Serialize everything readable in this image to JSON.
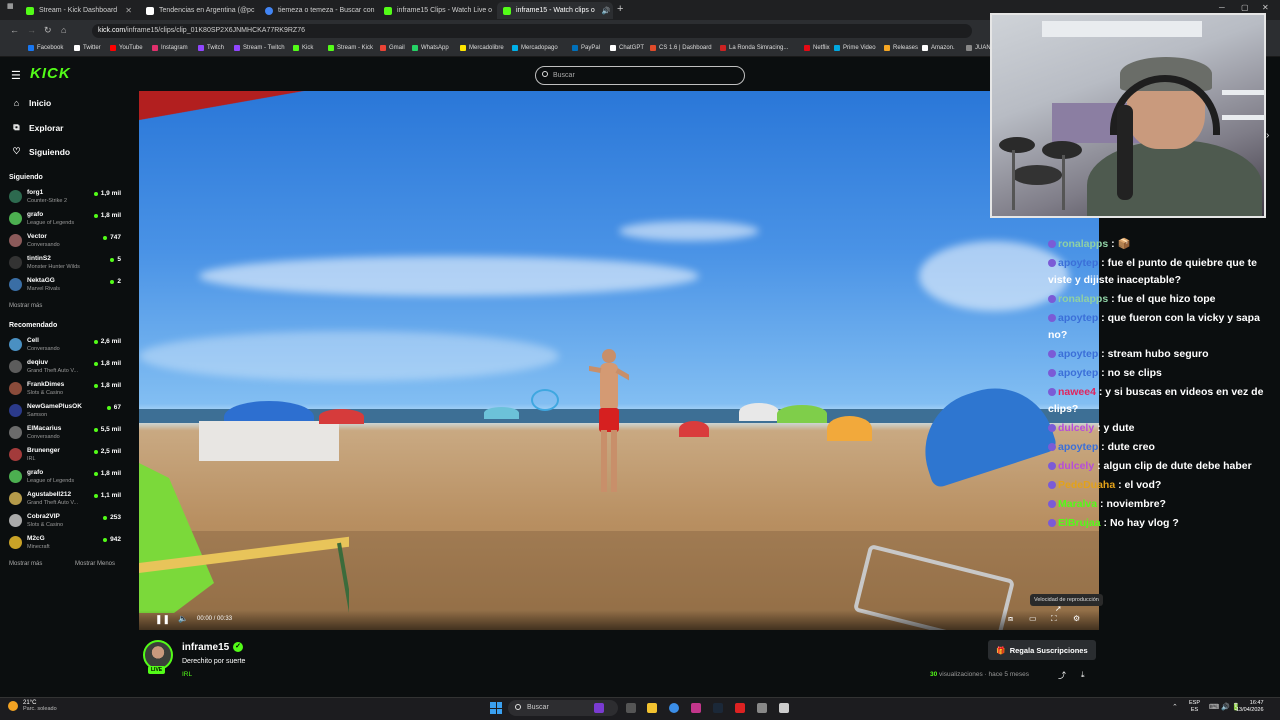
{
  "browser": {
    "tabs": [
      {
        "title": "Stream - Kick Dashboard",
        "color": "#53fc18"
      },
      {
        "title": "Tendencias en Argentina (@pc",
        "color": "#ffffff"
      },
      {
        "title": "tiemeza o temeza - Buscar con",
        "color": "#4285f4"
      },
      {
        "title": "inframe15 Clips - Watch Live o",
        "color": "#53fc18"
      },
      {
        "title": "inframe15 - Watch clips o",
        "color": "#53fc18"
      }
    ],
    "url_host": "kick.com",
    "url_path": "/inframe15/clips/clip_01K80SP2X6JNMHCKA77RK9RZ76",
    "bookmarks": [
      {
        "label": "Facebook",
        "color": "#1877f2"
      },
      {
        "label": "Twitter",
        "color": "#ffffff"
      },
      {
        "label": "YouTube",
        "color": "#ff0000"
      },
      {
        "label": "Instagram",
        "color": "#e1306c"
      },
      {
        "label": "Twitch",
        "color": "#9146ff"
      },
      {
        "label": "Stream - Twitch",
        "color": "#9146ff"
      },
      {
        "label": "Kick",
        "color": "#53fc18"
      },
      {
        "label": "Stream - Kick",
        "color": "#53fc18"
      },
      {
        "label": "Gmail",
        "color": "#ea4335"
      },
      {
        "label": "WhatsApp",
        "color": "#25d366"
      },
      {
        "label": "Mercadolibre",
        "color": "#ffe600"
      },
      {
        "label": "Mercadopago",
        "color": "#00b1ea"
      },
      {
        "label": "PayPal",
        "color": "#0070ba"
      },
      {
        "label": "ChatGPT",
        "color": "#ffffff"
      },
      {
        "label": "CS 1.6 | Dashboard",
        "color": "#e04b2a"
      },
      {
        "label": "La Ronda Simracing...",
        "color": "#cc2222"
      },
      {
        "label": "Netflix",
        "color": "#e50914"
      },
      {
        "label": "Prime Video",
        "color": "#00a8e1"
      },
      {
        "label": "Releases",
        "color": "#f5a623"
      },
      {
        "label": "Amazon.",
        "color": "#ffffff"
      },
      {
        "label": "JUAN",
        "color": "#888888"
      }
    ]
  },
  "kick": {
    "logo": "KICK",
    "search_placeholder": "Buscar",
    "nav": [
      {
        "label": "Inicio",
        "icon": "home-icon"
      },
      {
        "label": "Explorar",
        "icon": "compass-icon"
      },
      {
        "label": "Siguiendo",
        "icon": "heart-icon"
      }
    ],
    "following_header": "Siguiendo",
    "following": [
      {
        "name": "forg1",
        "game": "Counter-Strike 2",
        "viewers": "1,9 mil",
        "color": "#2d6a4f"
      },
      {
        "name": "grafo",
        "game": "League of Legends",
        "viewers": "1,8 mil",
        "color": "#4caf50"
      },
      {
        "name": "Vector",
        "game": "Conversando",
        "viewers": "747",
        "color": "#8b5a5a"
      },
      {
        "name": "tintinS2",
        "game": "Monster Hunter Wilds",
        "viewers": "5",
        "color": "#333333"
      },
      {
        "name": "NektaGG",
        "game": "Marvel Rivals",
        "viewers": "2",
        "color": "#3a6ea5"
      }
    ],
    "show_more": "Mostrar más",
    "recommended_header": "Recomendado",
    "recommended": [
      {
        "name": "Cell",
        "game": "Conversando",
        "viewers": "2,6 mil",
        "color": "#4a90c2"
      },
      {
        "name": "deqiuv",
        "game": "Grand Theft Auto V...",
        "viewers": "1,8 mil",
        "color": "#5c5c5c"
      },
      {
        "name": "FrankDimes",
        "game": "Slots & Casino",
        "viewers": "1,8 mil",
        "color": "#8a4b3a"
      },
      {
        "name": "NewGamePlusOK",
        "game": "Samson",
        "viewers": "67",
        "color": "#2b3a8a"
      },
      {
        "name": "ElMacarius",
        "game": "Conversando",
        "viewers": "5,5 mil",
        "color": "#6b6b6b"
      },
      {
        "name": "Brunenger",
        "game": "IRL",
        "viewers": "2,5 mil",
        "color": "#a33b3b"
      },
      {
        "name": "grafo",
        "game": "League of Legends",
        "viewers": "1,8 mil",
        "color": "#4caf50"
      },
      {
        "name": "Agustabell212",
        "game": "Grand Theft Auto V...",
        "viewers": "1,1 mil",
        "color": "#b59b4a"
      },
      {
        "name": "Cobra2VIP",
        "game": "Slots & Casino",
        "viewers": "253",
        "color": "#aaaaaa"
      },
      {
        "name": "M2cG",
        "game": "Minecraft",
        "viewers": "942",
        "color": "#c9a227"
      }
    ],
    "show_more_2": "Mostrar más",
    "show_less": "Mostrar Menos"
  },
  "player": {
    "current_time": "00:00",
    "duration": "00:33",
    "tooltip": "Velocidad de reproducción"
  },
  "chat": [
    {
      "user": "ronalapps",
      "text": " : 📦",
      "color": "#8fd0a4"
    },
    {
      "user": "apoytep",
      "text": " : fue el punto de quiebre que te viste y dijiste inaceptable?",
      "color": "#3b6fd8"
    },
    {
      "user": "ronalapps",
      "text": " : fue el que hizo tope",
      "color": "#8fd0a4"
    },
    {
      "user": "apoytep",
      "text": " : que fueron con la vicky y sapa no?",
      "color": "#3b6fd8"
    },
    {
      "user": "apoytep",
      "text": " : stream hubo seguro",
      "color": "#3b6fd8"
    },
    {
      "user": "apoytep",
      "text": " : no se clips",
      "color": "#3b6fd8"
    },
    {
      "user": "nawee4",
      "text": " : y si buscas en videos en vez de clips?",
      "color": "#e0245e"
    },
    {
      "user": "dulcely",
      "text": " : y dute",
      "color": "#b64cdb"
    },
    {
      "user": "apoytep",
      "text": " : dute creo",
      "color": "#3b6fd8"
    },
    {
      "user": "dulcely",
      "text": " : algun clip de dute debe haber",
      "color": "#b64cdb"
    },
    {
      "user": "PedeDuaha",
      "text": " : el vod?",
      "color": "#e3a21a"
    },
    {
      "user": "Maralva",
      "text": " : noviembre?",
      "color": "#53fc18"
    },
    {
      "user": "ElBrujaa",
      "text": " : No hay vlog ?",
      "color": "#53fc18"
    }
  ],
  "channel": {
    "name": "inframe15",
    "live_badge": "LIVE",
    "clip_title": "Derechito por suerte",
    "category": "IRL",
    "gift_button": "Regala Suscripciones",
    "views_count": "30",
    "views_label": " visualizaciones · hace 5 meses"
  },
  "taskbar": {
    "temperature": "21°C",
    "weather": "Parc. soleado",
    "search": "Buscar",
    "lang1": "ESP",
    "lang2": "ES",
    "time": "16:47",
    "date": "13/04/2026"
  }
}
